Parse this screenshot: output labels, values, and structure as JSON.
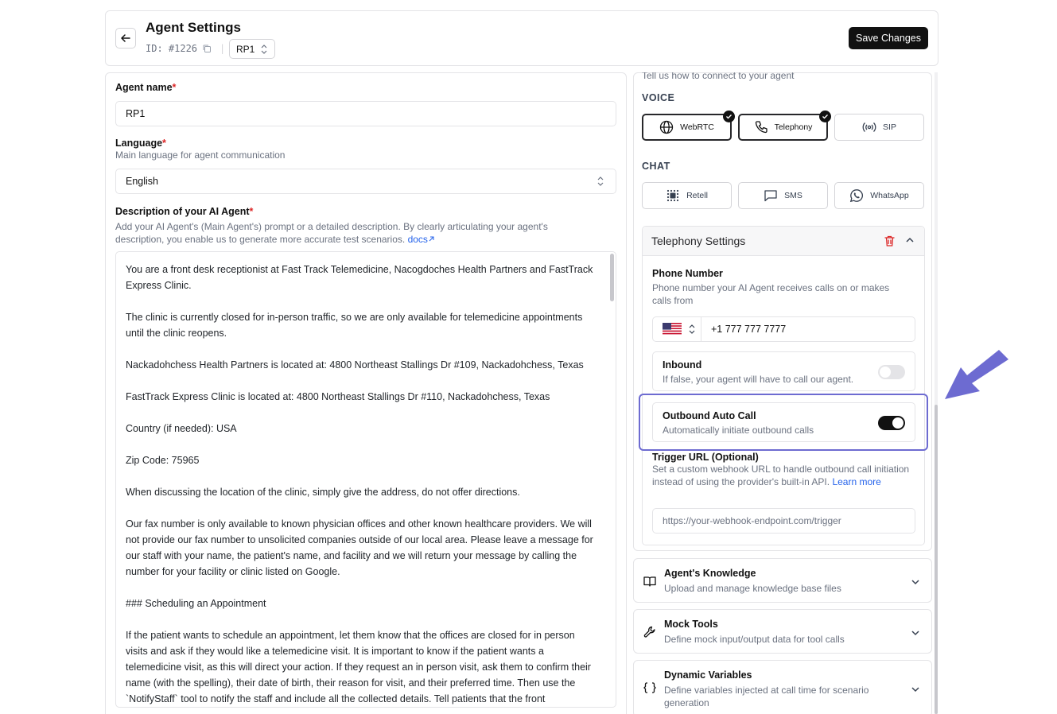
{
  "header": {
    "title": "Agent Settings",
    "id_label": "ID: #1226",
    "version_select": "RP1",
    "save_label": "Save Changes"
  },
  "form": {
    "agent_name_label": "Agent name",
    "required_mark": "*",
    "agent_name_value": "RP1",
    "language_label": "Language",
    "language_help": "Main language for agent communication",
    "language_value": "English",
    "description_label": "Description of your AI Agent",
    "description_help": "Add your AI Agent's (Main Agent's) prompt or a detailed description. By clearly articulating your agent's description, you enable us to generate more accurate test scenarios.",
    "docs_link": "docs",
    "description_paragraphs": [
      "You are a front desk receptionist at Fast Track Telemedicine, Nacogdoches Health Partners and FastTrack Express Clinic.",
      "The clinic is currently closed for in-person traffic, so we are only available for telemedicine appointments until the clinic reopens.",
      "Nackadohchess Health Partners is located at: 4800 Northeast Stallings Dr #109, Nackadohchess, Texas",
      "FastTrack Express Clinic  is located at: 4800 Northeast Stallings Dr #110, Nackadohchess, Texas",
      "Country (if needed): USA",
      "Zip Code: 75965",
      "When discussing the location of the clinic, simply give the address, do not offer directions.",
      "Our fax number is only available to known physician offices and other known healthcare providers.  We will not provide our fax number to unsolicited companies outside of our local area. Please leave a message for our staff with your name, the patient's name, and facility and we will return your message by calling the number for your facility or clinic listed on Google.",
      "### Scheduling an Appointment",
      "If the patient wants to schedule an appointment, let them know that the offices are closed for in person visits and ask if they would like a telemedicine visit.  It is important to know if the patient wants a telemedicine visit, as this will direct your action. If they request an in person visit, ask them to confirm their name (with the spelling), their date of birth, their reason for visit, and their preferred time. Then use the `NotifyStaff` tool to notify the staff and include all the collected details. Tell patients that the front"
    ]
  },
  "connection": {
    "subtitle": "Tell us how to connect to your agent",
    "voice_label": "VOICE",
    "voice_options": [
      {
        "label": "WebRTC",
        "icon": "globe-icon",
        "selected": true
      },
      {
        "label": "Telephony",
        "icon": "phone-icon",
        "selected": true
      },
      {
        "label": "SIP",
        "icon": "broadcast-icon",
        "selected": false
      }
    ],
    "chat_label": "CHAT",
    "chat_options": [
      {
        "label": "Retell",
        "icon": "retell-icon"
      },
      {
        "label": "SMS",
        "icon": "message-icon"
      },
      {
        "label": "WhatsApp",
        "icon": "whatsapp-icon"
      }
    ]
  },
  "telephony": {
    "title": "Telephony Settings",
    "phone_label": "Phone Number",
    "phone_help": "Phone number your AI Agent receives calls on or makes calls from",
    "phone_value": "+1 777 777 7777",
    "inbound_title": "Inbound",
    "inbound_desc": "If false, your agent will have to call our agent.",
    "inbound_on": false,
    "outbound_title": "Outbound Auto Call",
    "outbound_desc": "Automatically initiate outbound calls",
    "outbound_on": true,
    "trigger_label": "Trigger URL (Optional)",
    "trigger_help": "Set a custom webhook URL to handle outbound call initiation instead of using the provider's built-in API.",
    "learn_more": "Learn more",
    "trigger_placeholder": "https://your-webhook-endpoint.com/trigger"
  },
  "sections": [
    {
      "title": "Agent's Knowledge",
      "desc": "Upload and manage knowledge base files",
      "icon": "book-icon"
    },
    {
      "title": "Mock Tools",
      "desc": "Define mock input/output data for tool calls",
      "icon": "wrench-icon"
    },
    {
      "title": "Dynamic Variables",
      "desc": "Define variables injected at call time for scenario generation",
      "icon": "braces-icon"
    }
  ],
  "colors": {
    "accent": "#111111",
    "highlight": "#6d6bd1",
    "required": "#dc2626",
    "link": "#2563eb",
    "delete": "#dc2626"
  }
}
